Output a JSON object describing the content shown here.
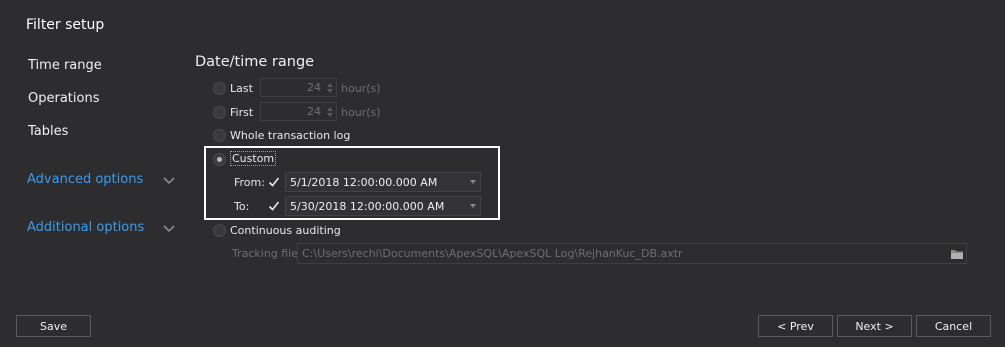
{
  "header": {
    "title": "Filter setup"
  },
  "sidebar": {
    "items": [
      {
        "label": "Time range"
      },
      {
        "label": "Operations"
      },
      {
        "label": "Tables"
      }
    ],
    "links": [
      {
        "label": "Advanced options",
        "icon": "chevron-down-icon"
      },
      {
        "label": "Additional options",
        "icon": "chevron-down-icon"
      }
    ]
  },
  "main": {
    "section_title": "Date/time range",
    "options": {
      "last": {
        "label": "Last",
        "value": "24",
        "unit": "hour(s)",
        "selected": false
      },
      "first": {
        "label": "First",
        "value": "24",
        "unit": "hour(s)",
        "selected": false
      },
      "whole": {
        "label": "Whole transaction log",
        "selected": false
      },
      "custom": {
        "label": "Custom",
        "selected": true
      },
      "continuous": {
        "label": "Continuous auditing",
        "selected": false
      }
    },
    "from": {
      "label": "From:",
      "checked": true,
      "value": "5/1/2018 12:00:00.000 AM"
    },
    "to": {
      "label": "To:",
      "checked": true,
      "value": "5/30/2018 12:00:00.000 AM"
    },
    "tracking": {
      "label": "Tracking file:",
      "value": "C:\\Users\\rechi\\Documents\\ApexSQL\\ApexSQL Log\\RejhanKuc_DB.axtr",
      "icon": "folder-icon"
    }
  },
  "footer": {
    "save": "Save",
    "prev": "< Prev",
    "next": "Next >",
    "cancel": "Cancel"
  },
  "colors": {
    "background": "#2d2d30",
    "link": "#3d9bea",
    "highlight": "#ffffff"
  }
}
